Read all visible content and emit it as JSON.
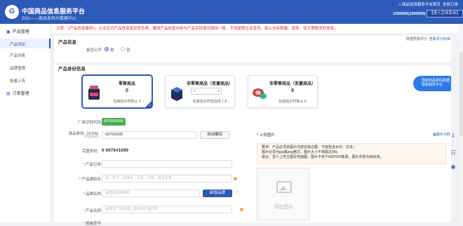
{
  "header": {
    "logo_text": "G",
    "title": "中国商品信息服务平台",
    "subtitle": "GS1——商品条码大数据中心",
    "home_link": "商品信息服务平台首页",
    "orders_link": "全部订单",
    "account": "1000000(1000000)",
    "enterprise_button": "【进入企业后台】"
  },
  "sidebar": {
    "group1": "产品管理",
    "items": [
      "产品添加",
      "产品列表",
      "品牌管理",
      "批量上传"
    ],
    "group2": "订单管理"
  },
  "notice": "注意：《产品信息服务》，企业应对产品信息真实性负责，确保产品信息内容与产品实际情况保持一致，不得虚假企业宣传，禁止含有欺骗、误导、夸大等情况的信息。",
  "product_info": {
    "title": "产品信息",
    "data_quality_label": "数据质量评分:",
    "data_quality_link": "查看评分标准",
    "public_label": "是否公开",
    "yes": "是",
    "no": "否"
  },
  "identity": {
    "title": "产品身份信息",
    "cards": [
      {
        "title": "零售商品",
        "count": "0",
        "footer": "包装指示符数从 0"
      },
      {
        "title": "非零售商品（变量商品）",
        "select": "1",
        "footer": "包装指示符值选择 1-8"
      },
      {
        "title": "非零售商品（变量商品）",
        "count": "9",
        "footer": "包装指示符数从 9"
      }
    ],
    "ad_badge": "国家商品条码数据智能服务平台"
  },
  "form": {
    "prefix_label": "厂商识别代码",
    "prefix_value": "697641699",
    "barcode_label": "商品条码（GTIN）",
    "barcode_sub": "（产品条码）",
    "barcode_value": "697641699",
    "auto_code_btn": "自动编码",
    "full_label": "完整条码",
    "full_value": "0 697641699",
    "category_label": "产品分类",
    "common_name_label": "产品通用名",
    "common_name_placeholder": "如：饼干、纯净水、手机、牛奶、洗发水等",
    "brand_label": "品牌名称",
    "brand_placeholder": "请选择品牌名称",
    "new_brand_btn": "新增品牌",
    "product_name_label": "产品名称",
    "product_name_placeholder": "请填写产品包装上显示的产品名称",
    "spec_label": "规格型号"
  },
  "upload": {
    "title": "* 上传图片",
    "example": "图片示例",
    "req1": "要求：产品必须去图片内容去除边框、不能包含水印、文本；",
    "req2": "图片必须为jpg或png格式，图片大小不得超过5M。",
    "req3": "建议：至少上传主图及背面图，图片不低于600*600像素，图片背景为纯白色。",
    "add_text": "添加图片"
  },
  "colors": {
    "primary": "#2d5ab8",
    "warning": "#e02d2d",
    "success": "#4caf50"
  }
}
